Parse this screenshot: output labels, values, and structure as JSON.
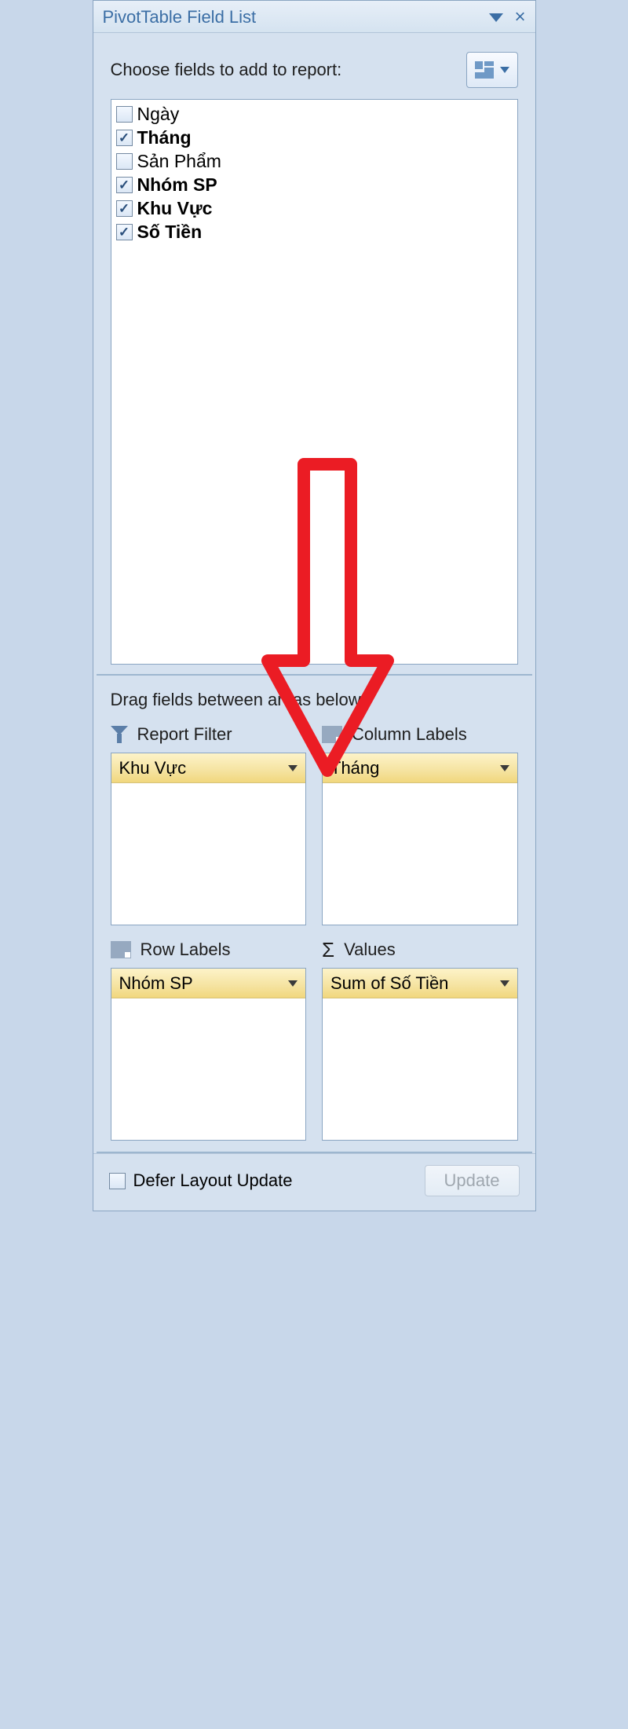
{
  "titlebar": {
    "title": "PivotTable Field List"
  },
  "choose": {
    "label": "Choose fields to add to report:"
  },
  "fields": [
    {
      "label": "Ngày",
      "checked": false,
      "bold": false
    },
    {
      "label": "Tháng",
      "checked": true,
      "bold": true
    },
    {
      "label": "Sản Phẩm",
      "checked": false,
      "bold": false
    },
    {
      "label": "Nhóm SP",
      "checked": true,
      "bold": true
    },
    {
      "label": "Khu Vực",
      "checked": true,
      "bold": true
    },
    {
      "label": "Số Tiền",
      "checked": true,
      "bold": true
    }
  ],
  "drag": {
    "label": "Drag fields between areas below:",
    "areas": {
      "filter": {
        "title": "Report Filter",
        "items": [
          "Khu Vực"
        ]
      },
      "columns": {
        "title": "Column Labels",
        "items": [
          "Tháng"
        ]
      },
      "rows": {
        "title": "Row Labels",
        "items": [
          "Nhóm SP"
        ]
      },
      "values": {
        "title": "Values",
        "items": [
          "Sum of Số Tiền"
        ]
      }
    }
  },
  "footer": {
    "defer_label": "Defer Layout Update",
    "update_label": "Update"
  }
}
